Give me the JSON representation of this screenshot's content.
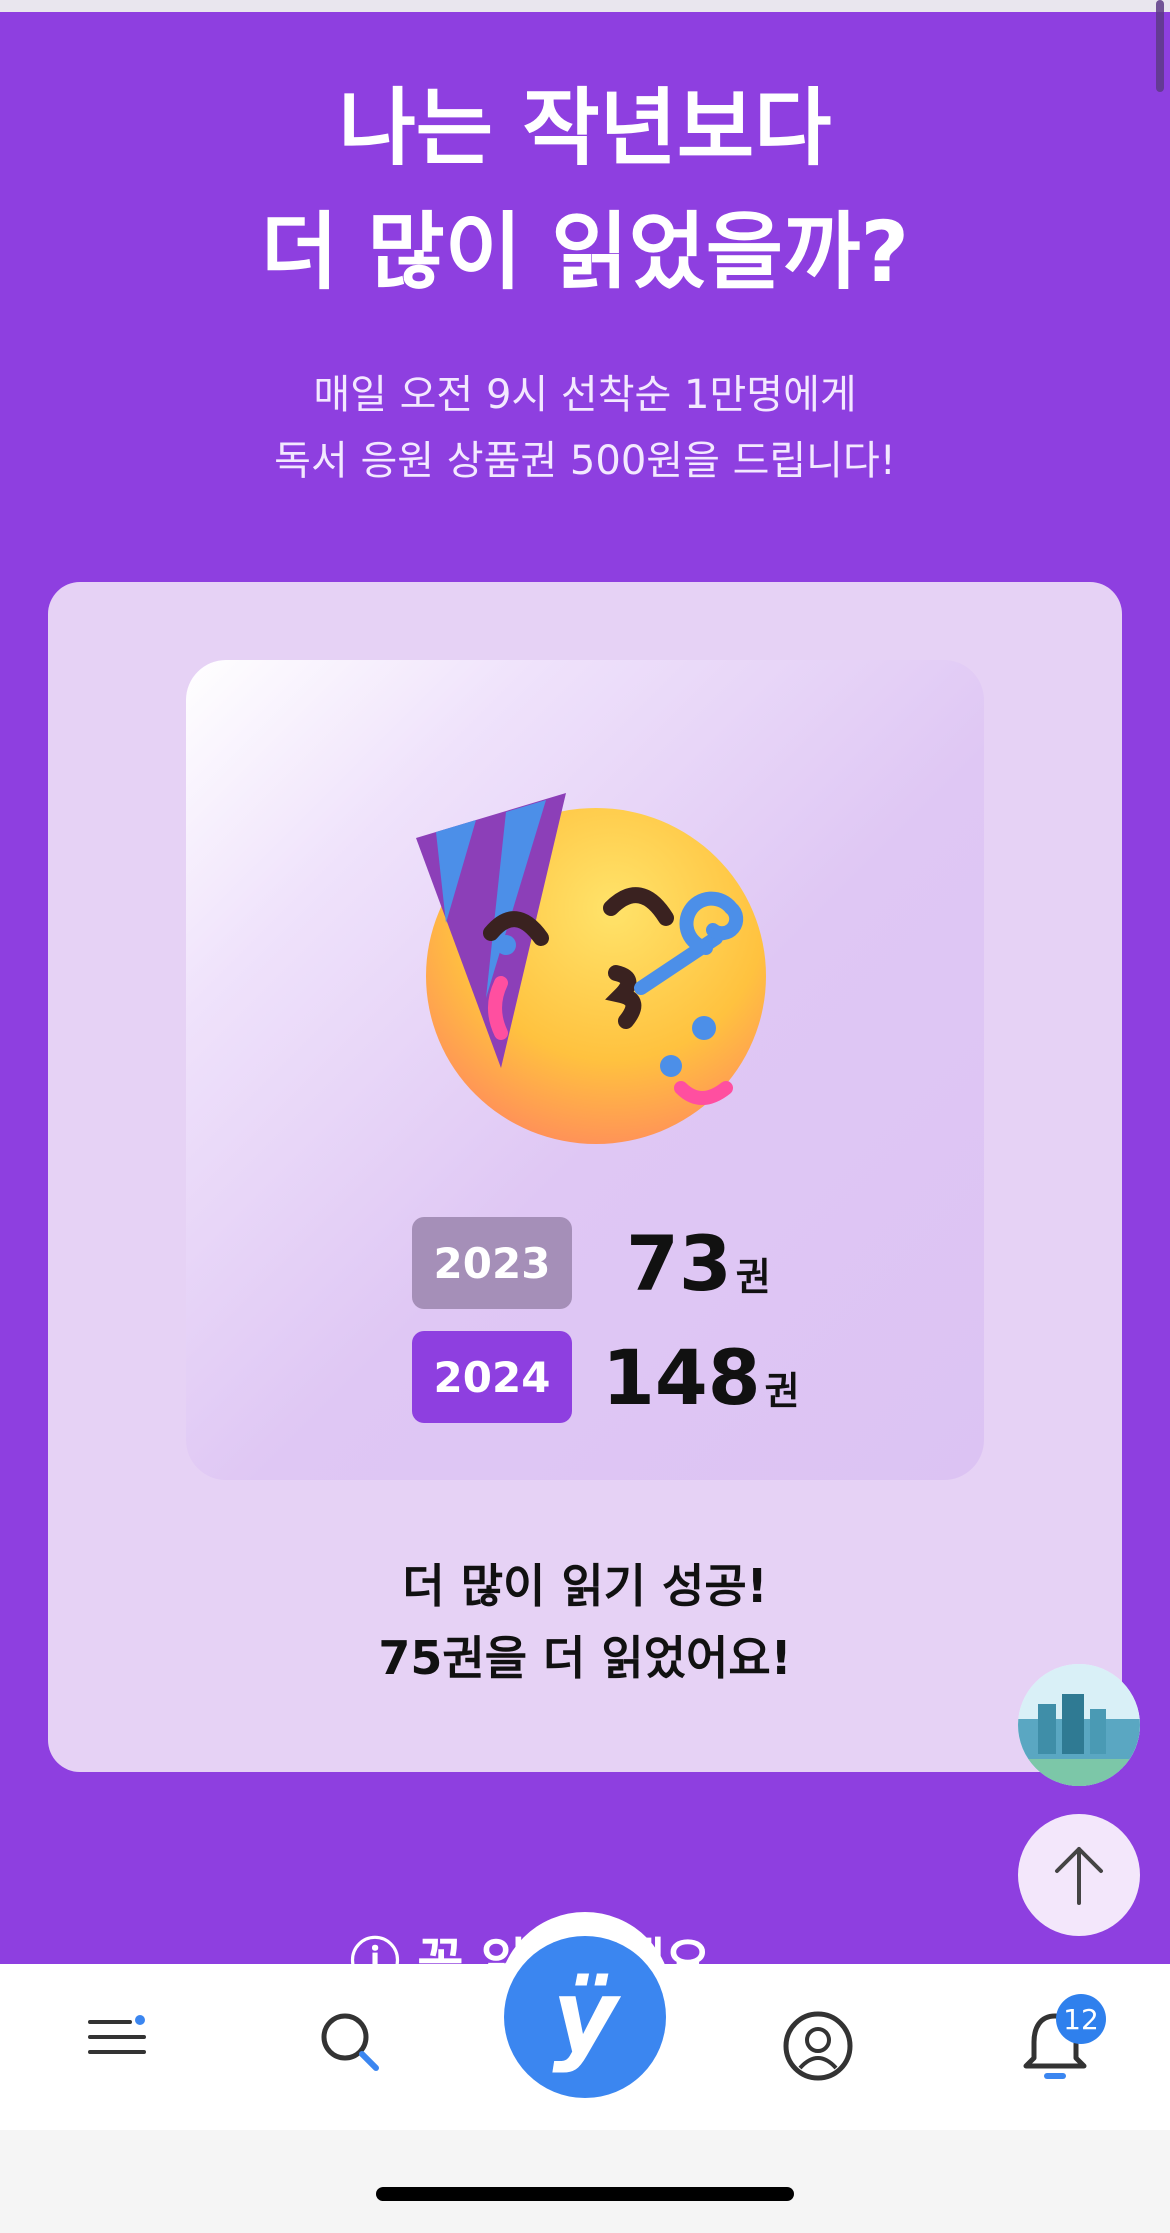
{
  "hero": {
    "title_line1": "나는 작년보다",
    "title_line2": "더 많이 읽었을까?",
    "subtitle_line1": "매일 오전 9시 선착순 1만명에게",
    "subtitle_line2": "독서 응원 상품권 500원을 드립니다!"
  },
  "stats": {
    "rows": [
      {
        "year": "2023",
        "count": "73",
        "unit": "권",
        "color": "#a58fb8"
      },
      {
        "year": "2024",
        "count": "148",
        "unit": "권",
        "color": "#8e3fe0"
      }
    ],
    "result_line1": "더 많이 읽기 성공!",
    "result_line2": "75권을 더 읽었어요!"
  },
  "peek_text": "꼭 읽어주세요",
  "tabbar": {
    "items": [
      "menu-icon",
      "search-icon",
      "yes24-logo",
      "profile-icon",
      "bell-icon"
    ],
    "center_logo": "ÿ",
    "notification_badge": "12"
  },
  "colors": {
    "accent": "#8e3fe0",
    "card": "#e6d2f5",
    "tab_accent": "#3b86f0"
  }
}
